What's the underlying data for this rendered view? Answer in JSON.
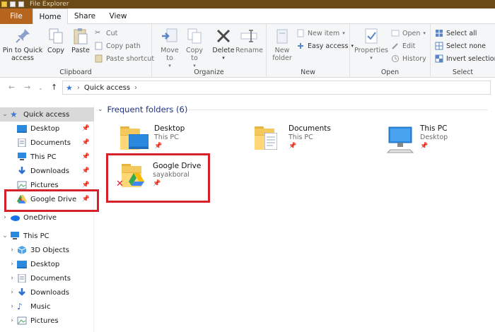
{
  "window": {
    "title": "File Explorer"
  },
  "tabs": {
    "file": "File",
    "home": "Home",
    "share": "Share",
    "view": "View"
  },
  "ribbon": {
    "clipboard": {
      "label": "Clipboard",
      "pin": "Pin to Quick access",
      "copy": "Copy",
      "paste": "Paste",
      "cut": "Cut",
      "copy_path": "Copy path",
      "paste_shortcut": "Paste shortcut"
    },
    "organize": {
      "label": "Organize",
      "move_to": "Move to",
      "copy_to": "Copy to",
      "delete": "Delete",
      "rename": "Rename"
    },
    "new": {
      "label": "New",
      "new_folder": "New folder",
      "new_item": "New item",
      "easy_access": "Easy access"
    },
    "open": {
      "label": "Open",
      "properties": "Properties",
      "open": "Open",
      "edit": "Edit",
      "history": "History"
    },
    "select": {
      "label": "Select",
      "select_all": "Select all",
      "select_none": "Select none",
      "invert": "Invert selection"
    }
  },
  "address": {
    "path": "Quick access"
  },
  "nav": {
    "quick_access": "Quick access",
    "pinned": [
      "Desktop",
      "Documents",
      "This PC",
      "Downloads",
      "Pictures",
      "Google Drive"
    ],
    "onedrive": "OneDrive",
    "this_pc": "This PC",
    "pc_children": [
      "3D Objects",
      "Desktop",
      "Documents",
      "Downloads",
      "Music",
      "Pictures"
    ]
  },
  "content": {
    "section_title": "Frequent folders (6)",
    "folders": [
      {
        "name": "Desktop",
        "location": "This PC"
      },
      {
        "name": "Documents",
        "location": "This PC"
      },
      {
        "name": "This PC",
        "location": "Desktop"
      },
      {
        "name": "Google Drive",
        "location": "sayakboral"
      }
    ]
  },
  "colors": {
    "highlight_box": "#d6202a",
    "file_tab": "#b5651d",
    "section_title": "#1e3287"
  }
}
